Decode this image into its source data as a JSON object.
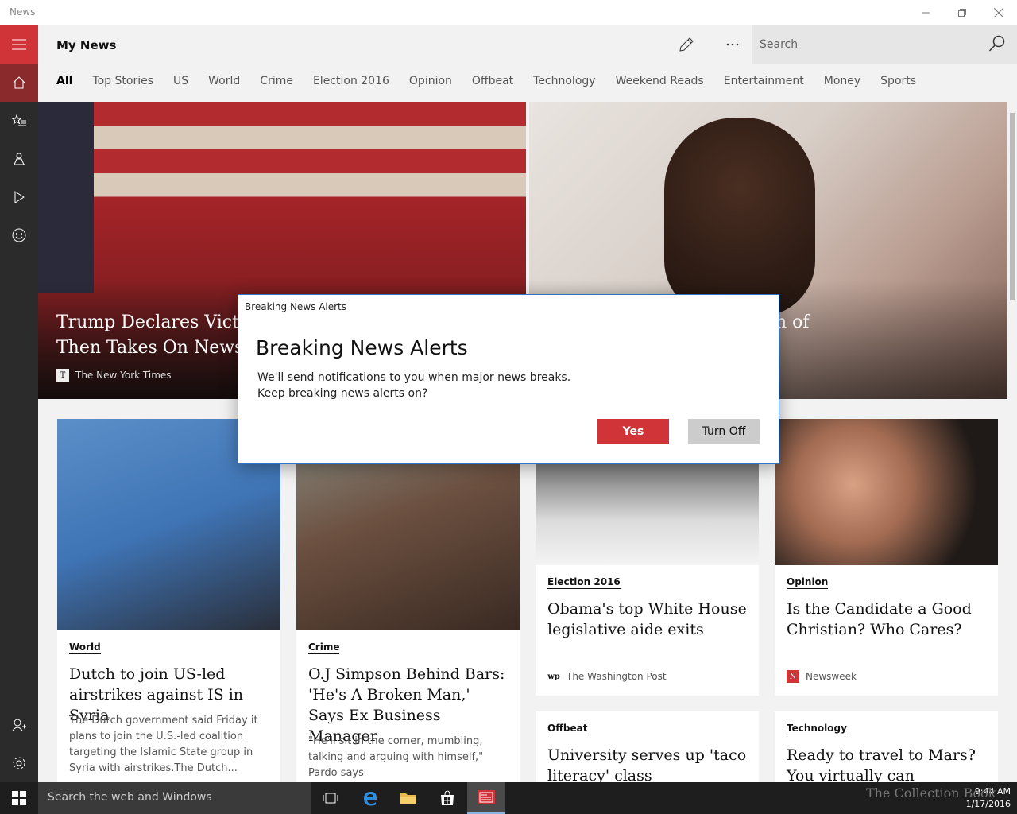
{
  "window": {
    "title": "News"
  },
  "header": {
    "page_title": "My News",
    "search_placeholder": "Search"
  },
  "tabs": [
    "All",
    "Top Stories",
    "US",
    "World",
    "Crime",
    "Election 2016",
    "Opinion",
    "Offbeat",
    "Technology",
    "Weekend Reads",
    "Entertainment",
    "Money",
    "Sports"
  ],
  "active_tab": "All",
  "hero": [
    {
      "title": "Trump Declares Victo\nThen Takes On Newsp",
      "source": "The New York Times"
    },
    {
      "title_fragment": "h of"
    }
  ],
  "cards": [
    {
      "category": "World",
      "title": "Dutch to join US-led airstrikes against IS in Syria",
      "desc": "The Dutch government said Friday it plans to join the U.S.-led coalition targeting the Islamic State group in Syria with airstrikes.The Dutch..."
    },
    {
      "category": "Crime",
      "title": "O.J Simpson Behind Bars: 'He's A Broken Man,' Says Ex Business Manager",
      "desc": "\"He'll sit in the corner, mumbling, talking and arguing with himself,\" Pardo says"
    },
    {
      "category": "Election 2016",
      "title": "Obama's top White House legislative aide exits",
      "source": "The Washington Post"
    },
    {
      "category": "Opinion",
      "title": "Is the Candidate a Good Christian? Who Cares?",
      "source": "Newsweek"
    },
    {
      "category": "Offbeat",
      "title": "University serves up 'taco literacy' class"
    },
    {
      "category": "Technology",
      "title": "Ready to travel to Mars? You virtually can"
    }
  ],
  "modal": {
    "window_title": "Breaking News Alerts",
    "title": "Breaking News Alerts",
    "line1": "We'll send notifications to you when major news breaks.",
    "line2": "Keep breaking news alerts on?",
    "yes_label": "Yes",
    "off_label": "Turn Off"
  },
  "taskbar": {
    "search_text": "Search the web and Windows",
    "time": "9:44 AM",
    "date": "1/17/2016"
  },
  "watermark": "The Collection Book",
  "colors": {
    "accent": "#d13438",
    "sidebar": "#2b2b2b",
    "taskbar": "#1e1e1e"
  },
  "icons": [
    "hamburger-icon",
    "home-icon",
    "favorites-icon",
    "local-icon",
    "video-icon",
    "emoji-icon",
    "account-icon",
    "settings-icon",
    "pencil-icon",
    "more-icon",
    "search-icon"
  ]
}
